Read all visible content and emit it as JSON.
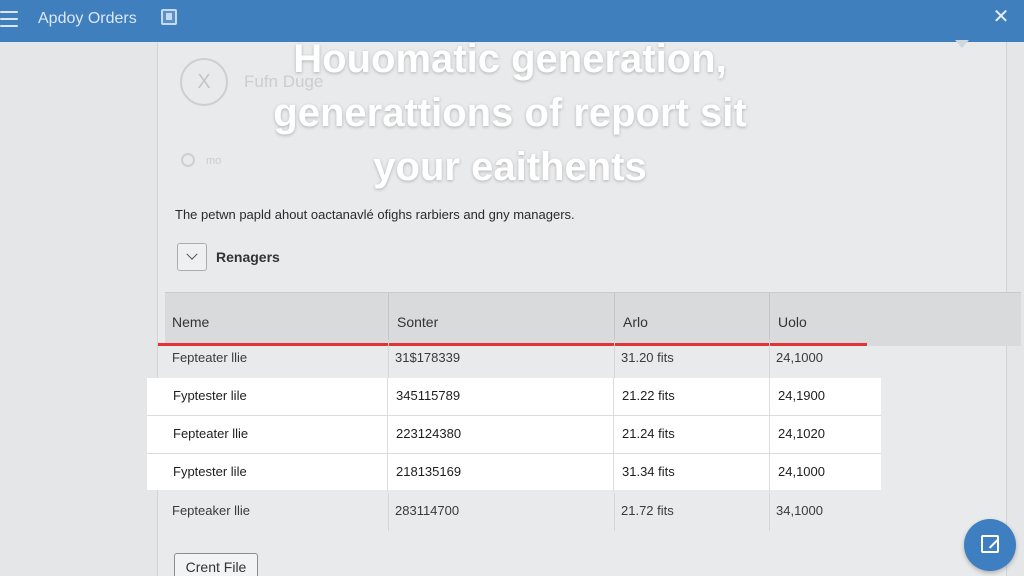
{
  "topbar": {
    "title": "Apdoy Orders",
    "close_label": "✕"
  },
  "profile": {
    "avatar_glyph": "X",
    "name": "Fufn Duge",
    "status_label": "mo"
  },
  "headline": {
    "line1": "Houomatic generation,",
    "line2": "generattions of report sit",
    "line3": "your eaithents"
  },
  "description": "The petwn papld ahout oactanavlé ofighs rarbiers and gny managers.",
  "dropdown": {
    "label": "Renagers"
  },
  "table": {
    "columns": [
      "Neme",
      "Sonter",
      "Arlo",
      "Uolo"
    ],
    "rows": [
      [
        "Fepteater llie",
        "31$178339",
        "31.20 fits",
        "24,1000"
      ],
      [
        "Fyptester lile",
        "345115789",
        "21.22 fits",
        "24,1900"
      ],
      [
        "Fepteater llie",
        "223124380",
        "21.24 fits",
        "24,1020"
      ],
      [
        "Fyptester lile",
        "218135169",
        "31.34 fits",
        "24,1000"
      ],
      [
        "Fepteaker llie",
        "283114700",
        "21.72 fits",
        "34,1000"
      ]
    ]
  },
  "actions": {
    "create_label": "Crent File"
  },
  "colors": {
    "topbar": "#3f7fbd",
    "highlight_line": "#e23434",
    "fab": "#3d7fc1"
  }
}
